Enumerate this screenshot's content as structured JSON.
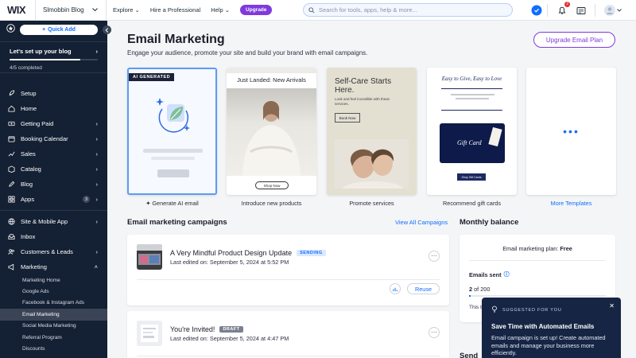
{
  "topbar": {
    "logo": "WIX",
    "site_name": "Slmobbin Blog",
    "nav": [
      "Explore",
      "Hire a Professional",
      "Help"
    ],
    "upgrade_pill": "Upgrade",
    "search_placeholder": "Search for tools, apps, help & more...",
    "notification_count": "2"
  },
  "sidebar": {
    "quick_add": "Quick Add",
    "setup_title": "Let's set up your blog",
    "setup_progress": 0.8,
    "setup_status": "4/5 completed",
    "items": [
      {
        "label": "Setup",
        "chevron": false
      },
      {
        "label": "Home",
        "chevron": false
      },
      {
        "label": "Getting Paid",
        "chevron": true
      },
      {
        "label": "Booking Calendar",
        "chevron": true
      },
      {
        "label": "Sales",
        "chevron": true
      },
      {
        "label": "Catalog",
        "chevron": true
      },
      {
        "label": "Blog",
        "chevron": true
      },
      {
        "label": "Apps",
        "chevron": true,
        "count": "3"
      }
    ],
    "items2": [
      {
        "label": "Site & Mobile App",
        "chevron": true
      },
      {
        "label": "Inbox",
        "chevron": false
      },
      {
        "label": "Customers & Leads",
        "chevron": true
      },
      {
        "label": "Marketing",
        "chevron": true
      }
    ],
    "marketing_sub": [
      "Marketing Home",
      "Google Ads",
      "Facebook & Instagram Ads",
      "Email Marketing",
      "Social Media Marketing",
      "Referral Program",
      "Discounts"
    ],
    "active_sub": "Email Marketing"
  },
  "main": {
    "title": "Email Marketing",
    "subtitle": "Engage your audience, promote your site and build your brand with email campaigns.",
    "upgrade_button": "Upgrade Email Plan",
    "templates": [
      {
        "label": "Generate AI email",
        "badge": "AI GENERATED"
      },
      {
        "label": "Introduce new products",
        "headline": "Just Landed: New Arrivals",
        "cta": "Shop Now"
      },
      {
        "label": "Promote services",
        "headline": "Self-Care Starts Here.",
        "body": "Look and feel incredible with these services.",
        "cta": "Book Now"
      },
      {
        "label": "Recommend gift cards",
        "headline": "Easy to Give, Easy to Love",
        "card_text": "Gift Card",
        "cta": "Shop Gift Cards"
      },
      {
        "label": "More Templates"
      }
    ],
    "campaigns_title": "Email marketing campaigns",
    "view_all": "View All Campaigns",
    "campaigns": [
      {
        "title": "A Very Mindful Product Design Update",
        "status": "SENDING",
        "date": "Last edited on: September 5, 2024 at 5:52 PM",
        "action": "Reuse"
      },
      {
        "title": "You're Invited!",
        "status": "DRAFT",
        "date": "Last edited on: September 5, 2024 at 4:47 PM"
      }
    ],
    "balance": {
      "title": "Monthly balance",
      "plan_prefix": "Email marketing plan: ",
      "plan": "Free",
      "sent_label": "Emails sent",
      "sent_count": "2",
      "sent_of": " of 200",
      "sent_fraction": 0.01,
      "footer_partial": "This b"
    },
    "next_section_partial": "Send"
  },
  "popup": {
    "kicker": "SUGGESTED FOR YOU",
    "title": "Save Time with Automated Emails",
    "body": "Email campaign is set up! Create automated emails and manage your business more efficiently."
  },
  "colors": {
    "accent": "#116dff",
    "brand_purple": "#7f3ade",
    "sidebar": "#142033",
    "sending": "#116dff",
    "draft": "#7a8090"
  }
}
